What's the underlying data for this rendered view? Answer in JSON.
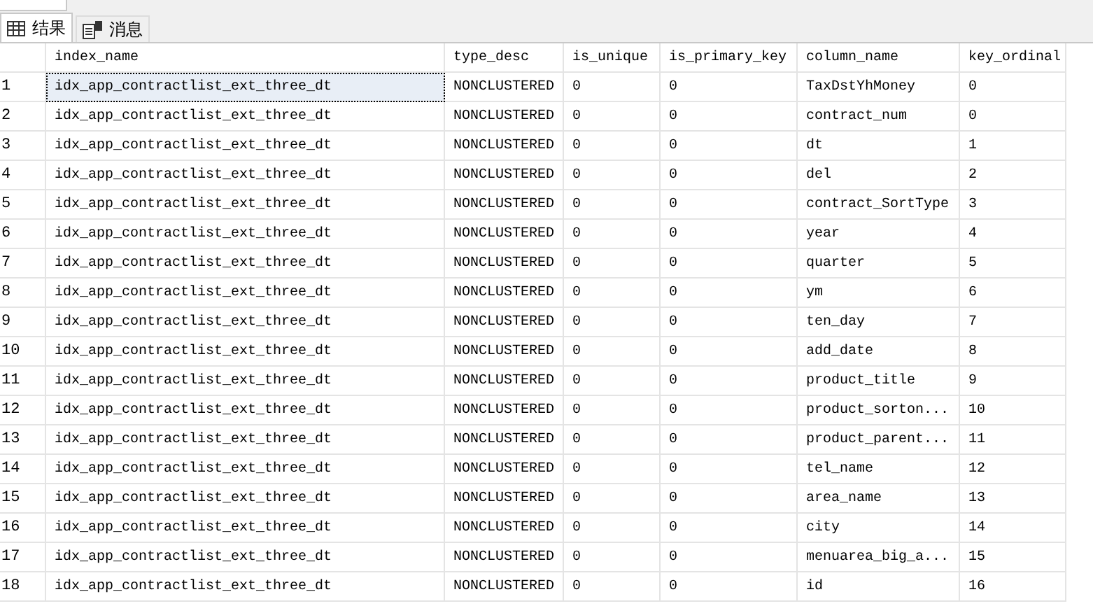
{
  "tabs": [
    {
      "label": "结果",
      "kind": "grid",
      "selected": true
    },
    {
      "label": "消息",
      "kind": "messages",
      "selected": false
    }
  ],
  "table": {
    "columns": [
      "index_name",
      "type_desc",
      "is_unique",
      "is_primary_key",
      "column_name",
      "key_ordinal"
    ],
    "rows": [
      {
        "number": "1",
        "focused": true,
        "cells": [
          "idx_app_contractlist_ext_three_dt",
          "NONCLUSTERED",
          "0",
          "0",
          "TaxDstYhMoney",
          "0"
        ]
      },
      {
        "number": "2",
        "focused": false,
        "cells": [
          "idx_app_contractlist_ext_three_dt",
          "NONCLUSTERED",
          "0",
          "0",
          "contract_num",
          "0"
        ]
      },
      {
        "number": "3",
        "focused": false,
        "cells": [
          "idx_app_contractlist_ext_three_dt",
          "NONCLUSTERED",
          "0",
          "0",
          "dt",
          "1"
        ]
      },
      {
        "number": "4",
        "focused": false,
        "cells": [
          "idx_app_contractlist_ext_three_dt",
          "NONCLUSTERED",
          "0",
          "0",
          "del",
          "2"
        ]
      },
      {
        "number": "5",
        "focused": false,
        "cells": [
          "idx_app_contractlist_ext_three_dt",
          "NONCLUSTERED",
          "0",
          "0",
          "contract_SortType",
          "3"
        ]
      },
      {
        "number": "6",
        "focused": false,
        "cells": [
          "idx_app_contractlist_ext_three_dt",
          "NONCLUSTERED",
          "0",
          "0",
          "year",
          "4"
        ]
      },
      {
        "number": "7",
        "focused": false,
        "cells": [
          "idx_app_contractlist_ext_three_dt",
          "NONCLUSTERED",
          "0",
          "0",
          "quarter",
          "5"
        ]
      },
      {
        "number": "8",
        "focused": false,
        "cells": [
          "idx_app_contractlist_ext_three_dt",
          "NONCLUSTERED",
          "0",
          "0",
          "ym",
          "6"
        ]
      },
      {
        "number": "9",
        "focused": false,
        "cells": [
          "idx_app_contractlist_ext_three_dt",
          "NONCLUSTERED",
          "0",
          "0",
          "ten_day",
          "7"
        ]
      },
      {
        "number": "10",
        "focused": false,
        "cells": [
          "idx_app_contractlist_ext_three_dt",
          "NONCLUSTERED",
          "0",
          "0",
          "add_date",
          "8"
        ]
      },
      {
        "number": "11",
        "focused": false,
        "cells": [
          "idx_app_contractlist_ext_three_dt",
          "NONCLUSTERED",
          "0",
          "0",
          "product_title",
          "9"
        ]
      },
      {
        "number": "12",
        "focused": false,
        "cells": [
          "idx_app_contractlist_ext_three_dt",
          "NONCLUSTERED",
          "0",
          "0",
          "product_sorton...",
          "10"
        ]
      },
      {
        "number": "13",
        "focused": false,
        "cells": [
          "idx_app_contractlist_ext_three_dt",
          "NONCLUSTERED",
          "0",
          "0",
          "product_parent...",
          "11"
        ]
      },
      {
        "number": "14",
        "focused": false,
        "cells": [
          "idx_app_contractlist_ext_three_dt",
          "NONCLUSTERED",
          "0",
          "0",
          "tel_name",
          "12"
        ]
      },
      {
        "number": "15",
        "focused": false,
        "cells": [
          "idx_app_contractlist_ext_three_dt",
          "NONCLUSTERED",
          "0",
          "0",
          "area_name",
          "13"
        ]
      },
      {
        "number": "16",
        "focused": false,
        "cells": [
          "idx_app_contractlist_ext_three_dt",
          "NONCLUSTERED",
          "0",
          "0",
          "city",
          "14"
        ]
      },
      {
        "number": "17",
        "focused": false,
        "cells": [
          "idx_app_contractlist_ext_three_dt",
          "NONCLUSTERED",
          "0",
          "0",
          "menuarea_big_a...",
          "15"
        ]
      },
      {
        "number": "18",
        "focused": false,
        "cells": [
          "idx_app_contractlist_ext_three_dt",
          "NONCLUSTERED",
          "0",
          "0",
          "id",
          "16"
        ]
      }
    ]
  }
}
